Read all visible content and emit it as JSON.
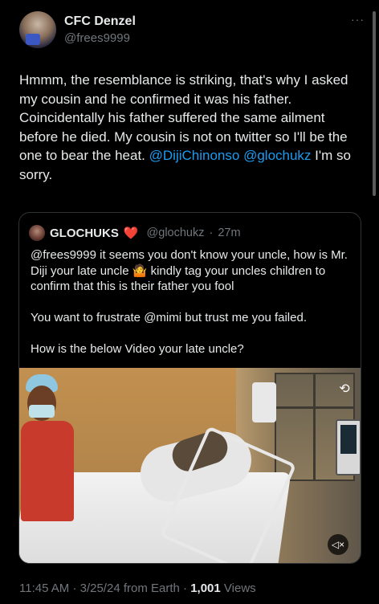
{
  "tweet": {
    "author_name": "CFC Denzel",
    "author_handle": "@frees9999",
    "more_icon": "more-horizontal-icon",
    "text_before_mentions": "Hmmm, the resemblance is striking, that's why I asked my cousin and he confirmed it was his father. Coincidentally his father suffered the same ailment before he died. My cousin is not on twitter so I'll be the one to bear the heat.",
    "mention_1": "@DijiChinonso",
    "mention_2": "@glochukz",
    "text_after_mentions": "I'm so sorry."
  },
  "quote": {
    "author_name": "GLOCHUKS",
    "heart_emoji": "❤️",
    "author_handle": "@glochukz",
    "separator": "·",
    "time_ago": "27m",
    "paragraph_1": "@frees9999 it seems you don't know your uncle, how is Mr. Diji your late uncle 🤷 kindly tag your uncles children to confirm that this is their father you fool",
    "paragraph_2": "You want to frustrate @mimi but trust me you failed.",
    "paragraph_3": "How is the below Video your late uncle?",
    "video_icons": [
      "gif-icon",
      "volume-muted-icon"
    ]
  },
  "footer": {
    "time": "11:45 AM",
    "separator_1": "·",
    "date": "3/25/24 from Earth",
    "separator_2": "·",
    "views_count": "1,001",
    "views_label": "Views"
  },
  "colors": {
    "background": "#000000",
    "text": "#e7e9ea",
    "muted": "#71767b",
    "link": "#1d9bf0",
    "border": "#2f3336"
  }
}
